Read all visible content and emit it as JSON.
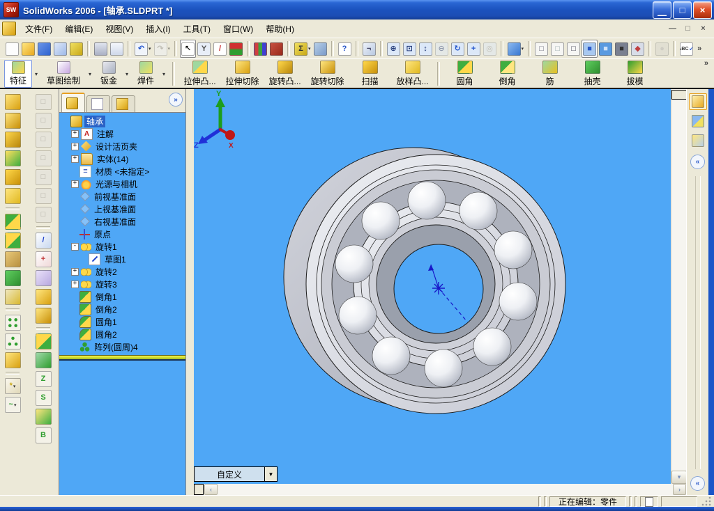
{
  "window": {
    "title": "SolidWorks 2006 - [轴承.SLDPRT *]",
    "app_icon": "SW",
    "controls": {
      "minimize": "—",
      "maximize": "□",
      "close": "×"
    },
    "mdi_controls": {
      "minimize": "—",
      "restore": "□",
      "close": "×"
    }
  },
  "menu": {
    "items": [
      {
        "name": "file",
        "label": "文件(F)"
      },
      {
        "name": "edit",
        "label": "编辑(E)"
      },
      {
        "name": "view",
        "label": "视图(V)"
      },
      {
        "name": "insert",
        "label": "插入(I)"
      },
      {
        "name": "tools",
        "label": "工具(T)"
      },
      {
        "name": "window",
        "label": "窗口(W)"
      },
      {
        "name": "help",
        "label": "帮助(H)"
      }
    ]
  },
  "standard_toolbar": {
    "groups": [
      [
        {
          "n": "new",
          "c": "#fdfdfd"
        },
        {
          "n": "open",
          "c": "linear-gradient(135deg,#ffe680,#e8a820)"
        },
        {
          "n": "save",
          "c": "linear-gradient(135deg,#6a94e8,#2f63cf)"
        },
        {
          "n": "sheet-format",
          "c": "linear-gradient(135deg,#dfe8f8,#9db8e8)"
        },
        {
          "n": "publish-edrawing",
          "c": "linear-gradient(135deg,#f0e060,#c8a818)"
        }
      ],
      [
        {
          "n": "print",
          "c": "linear-gradient(#dfe3ee,#aab0c4)"
        },
        {
          "n": "print-preview",
          "c": "linear-gradient(#f4f7fc,#cfd8ea)"
        }
      ],
      [
        {
          "n": "undo",
          "c": "#f0f4fa",
          "g": "↶",
          "gc": "#2255cc",
          "dd": true
        },
        {
          "n": "redo",
          "c": "#f0f4fa",
          "g": "↷",
          "gc": "#8a8a8a",
          "dd": true,
          "dis": true
        }
      ],
      [
        {
          "n": "select",
          "c": "#ffffff",
          "g": "↖",
          "gc": "#111",
          "pressed": true
        },
        {
          "n": "selection-filter",
          "c": "#e8eef8",
          "g": "Y",
          "gc": "#555"
        },
        {
          "n": "sketch-entity-color",
          "c": "#ffffff",
          "g": "/",
          "gc": "#cc3333"
        },
        {
          "n": "rebuild",
          "c": "linear-gradient(#d03030 42%,#2f9e2f 58%)"
        }
      ],
      [
        {
          "n": "edit-color",
          "c": "linear-gradient(90deg,#d04040 33%,#40a040 33% 66%,#4040d0 66%)"
        },
        {
          "n": "texture",
          "c": "linear-gradient(135deg,#c85040,#982a1a)"
        }
      ],
      [
        {
          "n": "measure",
          "c": "linear-gradient(135deg,#f0e060,#c8a818)",
          "g": "Σ",
          "gc": "#333",
          "dd": true
        },
        {
          "n": "mass-properties",
          "c": "linear-gradient(135deg,#b8d0e8,#7a9ac8)"
        }
      ],
      [
        {
          "n": "help",
          "c": "#ffffff",
          "g": "?",
          "gc": "#2a58c8"
        }
      ],
      [
        {
          "n": "flashlight",
          "c": "linear-gradient(135deg,#eef2fa,#b8c8e0)",
          "g": "¬",
          "gc": "#446"
        }
      ],
      [
        {
          "n": "zoom-to-fit",
          "c": "#dce8f8",
          "g": "⊕",
          "gc": "#223a78"
        },
        {
          "n": "zoom-to-area",
          "c": "#dce8f8",
          "g": "⊡",
          "gc": "#223a78"
        },
        {
          "n": "zoom-in-out",
          "c": "#dce8f8",
          "g": "↕",
          "gc": "#223a78"
        },
        {
          "n": "zoom-to-selection",
          "c": "#dce8f8",
          "g": "⊖",
          "gc": "#223a78",
          "dis": true
        },
        {
          "n": "rotate-view",
          "c": "#dce8f8",
          "g": "↻",
          "gc": "#2255cc"
        },
        {
          "n": "pan",
          "c": "#dce8f8",
          "g": "+",
          "gc": "#2255cc"
        },
        {
          "n": "3d-drawing-view",
          "c": "#dce8f8",
          "g": "◎",
          "gc": "#8a8a8a",
          "dis": true
        }
      ],
      [
        {
          "n": "view-orientation",
          "c": "linear-gradient(135deg,#8ab8f0,#3a78d0)",
          "dd": true
        }
      ],
      [
        {
          "n": "wireframe",
          "c": "#f6f6f4",
          "g": "□",
          "gc": "#667"
        },
        {
          "n": "hidden-lines-visible",
          "c": "#f6f6f4",
          "g": "□",
          "gc": "#9aa"
        },
        {
          "n": "hidden-lines-removed",
          "c": "#f6f6f4",
          "g": "□",
          "gc": "#334"
        },
        {
          "n": "shaded-with-edges",
          "c": "#a8c8f0",
          "g": "■",
          "gc": "#2a58c8",
          "pressed": true
        },
        {
          "n": "shaded",
          "c": "#5a9ae0",
          "g": "■",
          "gc": "#cfe2f8"
        },
        {
          "n": "shadows-in-shaded-mode",
          "c": "#7a8090",
          "g": "■",
          "gc": "#333"
        },
        {
          "n": "section-view",
          "c": "#d8dde8",
          "g": "◆",
          "gc": "#c04040"
        }
      ],
      [
        {
          "n": "perspective",
          "c": "#d4d4cc",
          "g": "●",
          "gc": "#aaa",
          "dis": true
        }
      ],
      [
        {
          "n": "spell-checker",
          "c": "#ffffff",
          "g": "✓",
          "gc": "#2255cc",
          "sub": "ABC"
        }
      ]
    ],
    "overflow": "»"
  },
  "feature_toolbar": {
    "groups": [
      {
        "name": "features",
        "label": "特征",
        "active": true,
        "c": "linear-gradient(135deg,#9fd89f,#ffd84a)"
      },
      {
        "name": "sketch",
        "label": "草图绘制",
        "active": false,
        "c": "linear-gradient(135deg,#ffffff,#c8a8e0)"
      },
      {
        "name": "sheet-metal",
        "label": "钣金",
        "active": false,
        "c": "linear-gradient(135deg,#e8e8ee,#a8b0c0)"
      },
      {
        "name": "weldments",
        "label": "焊件",
        "active": false,
        "c": "linear-gradient(135deg,#9fd89f,#f0e060)"
      }
    ],
    "tools": [
      {
        "name": "extruded-boss",
        "label": "拉伸凸...",
        "c": "linear-gradient(135deg,#9fd89f 45%,#ffd84a 45%)"
      },
      {
        "name": "extruded-cut",
        "label": "拉伸切除",
        "c": "linear-gradient(135deg,#ffe680,#d8a010)"
      },
      {
        "name": "revolved-boss",
        "label": "旋转凸...",
        "c": "linear-gradient(135deg,#ffd84a,#b8860b)"
      },
      {
        "name": "revolved-cut",
        "label": "旋转切除",
        "c": "linear-gradient(135deg,#ffe680,#c89008)"
      },
      {
        "name": "sweep",
        "label": "扫描",
        "c": "linear-gradient(135deg,#ffd84a,#c8900a)"
      },
      {
        "name": "loft",
        "label": "放样凸...",
        "c": "linear-gradient(135deg,#ffe680,#e0b820)",
        "sep_after": true
      },
      {
        "name": "fillet",
        "label": "圆角",
        "c": "linear-gradient(135deg,#3fae3f 45%,#ffd84a 45%)"
      },
      {
        "name": "chamfer",
        "label": "倒角",
        "c": "linear-gradient(135deg,#3fae3f 45%,#ffe680 45%)"
      },
      {
        "name": "rib",
        "label": "筋",
        "c": "linear-gradient(135deg,#9fd89f,#e8c020)"
      },
      {
        "name": "shell",
        "label": "抽壳",
        "c": "linear-gradient(135deg,#5fce5f,#2f8e2f)"
      },
      {
        "name": "draft",
        "label": "拔模",
        "c": "linear-gradient(135deg,#2f9e2f,#ffd84a)"
      }
    ],
    "overflow": "»"
  },
  "left_toolbar": {
    "col1": [
      {
        "n": "extruded-boss",
        "c": "linear-gradient(135deg,#ffe680,#d8a010)"
      },
      {
        "n": "extruded-cut",
        "c": "linear-gradient(135deg,#ffe680,#c89008)"
      },
      {
        "n": "revolved-boss",
        "c": "linear-gradient(135deg,#ffd84a,#b8860b)"
      },
      {
        "n": "revolved-cut",
        "c": "linear-gradient(135deg,#ffe060,#3fae3f)"
      },
      {
        "n": "swept-boss",
        "c": "linear-gradient(135deg,#ffd84a,#c89008)"
      },
      {
        "n": "lofted-boss",
        "c": "linear-gradient(135deg,#ffe680,#e0b820)"
      },
      "sep",
      {
        "n": "fillet",
        "c": "linear-gradient(135deg,#3fae3f 45%,#ffd84a 45%)"
      },
      {
        "n": "chamfer",
        "c": "linear-gradient(135deg,#ffd84a 55%,#3fae3f 55%)"
      },
      {
        "n": "rib",
        "c": "linear-gradient(135deg,#e8c878,#b89040)"
      },
      {
        "n": "shell",
        "c": "linear-gradient(135deg,#5fce5f,#2f8e2f)"
      },
      {
        "n": "draft",
        "c": "linear-gradient(135deg,#f0e8c0,#d8b830)"
      },
      "sep",
      {
        "n": "linear-pattern",
        "c": "radial-gradient(circle at 30% 30%,#2f9e2f 2px,rgba(0,0,0,0) 2.5px),radial-gradient(circle at 70% 30%,#2f9e2f 2px,rgba(0,0,0,0) 2.5px),radial-gradient(circle at 30% 70%,#2f9e2f 2px,rgba(0,0,0,0) 2.5px),radial-gradient(circle at 70% 70%,#2f9e2f 2px,rgba(0,0,0,0) 2.5px),linear-gradient(#f4f2e8,#f4f2e8)"
      },
      {
        "n": "circular-pattern",
        "c": "radial-gradient(circle at 50% 28%,#2f9e2f 2px,rgba(0,0,0,0) 2.5px),radial-gradient(circle at 28% 68%,#2f9e2f 2px,rgba(0,0,0,0) 2.5px),radial-gradient(circle at 72% 68%,#2f9e2f 2px,rgba(0,0,0,0) 2.5px),linear-gradient(#f4f2e8,#f4f2e8)"
      },
      {
        "n": "mirror",
        "c": "linear-gradient(135deg,#ffe680,#d8a010)"
      },
      "sep",
      {
        "n": "reference-geometry",
        "c": "linear-gradient(135deg,#fbf8ee,#e0d8b8)",
        "g": "*",
        "gc": "#c8a818",
        "dd": true
      },
      {
        "n": "curve",
        "c": "#f4f2e8",
        "g": "~",
        "gc": "#2f9e2f",
        "dd": true
      }
    ],
    "col2": [
      {
        "n": "standard-view-1",
        "c": "#e6e4da",
        "g": "□",
        "gc": "#b0aca0",
        "dis": true
      },
      {
        "n": "standard-view-2",
        "c": "#e6e4da",
        "g": "□",
        "gc": "#b0aca0",
        "dis": true
      },
      {
        "n": "standard-view-3",
        "c": "#e6e4da",
        "g": "□",
        "gc": "#b0aca0",
        "dis": true
      },
      {
        "n": "standard-view-4",
        "c": "#e6e4da",
        "g": "□",
        "gc": "#b0aca0",
        "dis": true
      },
      {
        "n": "standard-view-5",
        "c": "#e6e4da",
        "g": "□",
        "gc": "#b0aca0",
        "dis": true
      },
      {
        "n": "standard-view-6",
        "c": "#e6e4da",
        "g": "□",
        "gc": "#b0aca0",
        "dis": true
      },
      {
        "n": "standard-view-7",
        "c": "#e6e4da",
        "g": "□",
        "gc": "#b0aca0",
        "dis": true
      },
      "sep",
      {
        "n": "sketch",
        "c": "linear-gradient(135deg,#ffffff,#c8d8f0)",
        "g": "/",
        "gc": "#2244cc"
      },
      {
        "n": "3d-sketch",
        "c": "linear-gradient(135deg,#ffffff,#f0d8d8)",
        "g": "+",
        "gc": "#c03030"
      },
      {
        "n": "modify-sketch",
        "c": "linear-gradient(135deg,#e8e0f8,#b8a8e0)"
      },
      {
        "n": "convert-entities",
        "c": "linear-gradient(135deg,#ffe680,#d8a010)"
      },
      {
        "n": "offset-entities",
        "c": "linear-gradient(135deg,#ffe680,#c89008)"
      },
      "sep",
      {
        "n": "surfaces",
        "c": "linear-gradient(135deg,#ffd84a 55%,#3fae3f 55%)"
      },
      {
        "n": "thicken",
        "c": "linear-gradient(135deg,#9fd8a8,#2f9e2f)"
      },
      {
        "n": "spline",
        "c": "#f4f2e8",
        "g": "Z",
        "gc": "#2f9e2f"
      },
      {
        "n": "helix",
        "c": "#f4f2e8",
        "g": "S",
        "gc": "#2f9e2f"
      },
      {
        "n": "projected-curve",
        "c": "linear-gradient(135deg,#ffe680,#3fae3f)"
      },
      {
        "n": "composite-curve",
        "c": "#f4f2e8",
        "g": "B",
        "gc": "#2f9e2f"
      }
    ]
  },
  "feature_tree": {
    "tabs": [
      {
        "name": "featuremanager",
        "icon": "part",
        "active": true
      },
      {
        "name": "propertymanager",
        "icon": "propsheet",
        "active": false
      },
      {
        "name": "configurationmanager",
        "icon": "config",
        "active": false
      }
    ],
    "tab_overflow": "»",
    "items": [
      {
        "name": "part-root",
        "label": "轴承",
        "icon": "part",
        "level": 0,
        "selected": true
      },
      {
        "name": "annotations",
        "label": "注解",
        "icon": "ann",
        "level": 1,
        "expand": "+"
      },
      {
        "name": "design-binder",
        "label": "设计活页夹",
        "icon": "binder",
        "level": 1,
        "expand": "+"
      },
      {
        "name": "solid-bodies",
        "label": "实体(14)",
        "icon": "solids",
        "level": 1,
        "expand": "+"
      },
      {
        "name": "material",
        "label": "材质 <未指定>",
        "icon": "material",
        "level": 1
      },
      {
        "name": "lights-cameras",
        "label": "光源与相机",
        "icon": "lights",
        "level": 1,
        "expand": "+"
      },
      {
        "name": "front-plane",
        "label": "前视基准面",
        "icon": "plane",
        "level": 1
      },
      {
        "name": "top-plane",
        "label": "上视基准面",
        "icon": "plane",
        "level": 1
      },
      {
        "name": "right-plane",
        "label": "右视基准面",
        "icon": "plane",
        "level": 1
      },
      {
        "name": "origin",
        "label": "原点",
        "icon": "origin",
        "level": 1
      },
      {
        "name": "revolve1",
        "label": "旋转1",
        "icon": "revolve",
        "level": 1,
        "expand": "-"
      },
      {
        "name": "sketch1",
        "label": "草图1",
        "icon": "sketch",
        "level": 2
      },
      {
        "name": "revolve2",
        "label": "旋转2",
        "icon": "revolve",
        "level": 1,
        "expand": "+"
      },
      {
        "name": "revolve3",
        "label": "旋转3",
        "icon": "revolve",
        "level": 1,
        "expand": "+"
      },
      {
        "name": "chamfer1",
        "label": "倒角1",
        "icon": "chamfer",
        "level": 1
      },
      {
        "name": "chamfer2",
        "label": "倒角2",
        "icon": "chamfer",
        "level": 1
      },
      {
        "name": "fillet1",
        "label": "圆角1",
        "icon": "fillet",
        "level": 1
      },
      {
        "name": "fillet2",
        "label": "圆角2",
        "icon": "fillet",
        "level": 1
      },
      {
        "name": "cirpattern4",
        "label": "阵列(圆周)4",
        "icon": "cirpattern",
        "level": 1
      }
    ]
  },
  "viewport": {
    "view_selector": "自定义",
    "triad": {
      "x": "X",
      "y": "Y",
      "z": "Z"
    }
  },
  "task_pane": {
    "buttons": [
      {
        "name": "solidworks-resources",
        "active": true,
        "c": "linear-gradient(135deg,#fdf0b0,#e8a820)"
      },
      {
        "name": "design-library",
        "active": false,
        "c": "linear-gradient(135deg,#8ab8f0 50%,#f0e060 50%)"
      },
      {
        "name": "file-explorer",
        "active": false,
        "c": "linear-gradient(135deg,#ffe680,#b8d0e8)"
      }
    ],
    "collapse": "«"
  },
  "status_bar": {
    "editing_text": "正在编辑：零件"
  },
  "colors": {
    "viewport_bg": "#4FA7F6",
    "selection_bg": "#2B63C6",
    "titlebar_blue": "#1B52BE",
    "toolbar_bg": "#ECE9D8",
    "frame_blue": "#1A56C8"
  }
}
